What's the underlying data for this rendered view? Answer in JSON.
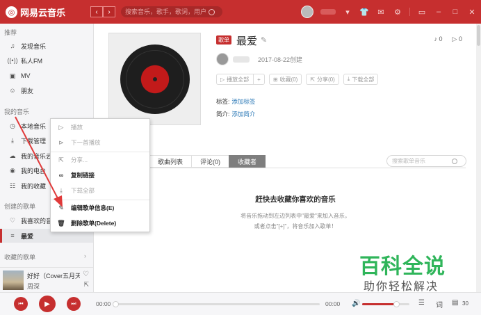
{
  "app": {
    "title": "网易云音乐"
  },
  "search": {
    "placeholder": "搜索音乐，歌手，歌词，用户"
  },
  "sidebar": {
    "section_recommend": "推荐",
    "recommend_items": [
      {
        "label": "发现音乐",
        "icon": "music-note-icon"
      },
      {
        "label": "私人FM",
        "icon": "radio-icon"
      },
      {
        "label": "MV",
        "icon": "mv-icon"
      },
      {
        "label": "朋友",
        "icon": "friends-icon"
      }
    ],
    "section_my_music": "我的音乐",
    "my_music_items": [
      {
        "label": "本地音乐",
        "icon": "local-music-icon"
      },
      {
        "label": "下载管理",
        "icon": "download-icon"
      },
      {
        "label": "我的音乐云盘",
        "icon": "cloud-icon"
      },
      {
        "label": "我的电台",
        "icon": "podcast-icon"
      },
      {
        "label": "我的收藏",
        "icon": "collect-icon"
      }
    ],
    "section_created": "创建的歌单",
    "created_items": [
      {
        "label": "我喜欢的音乐",
        "icon": "heart-icon"
      },
      {
        "label": "最爱",
        "icon": "playlist-icon",
        "active": true
      }
    ],
    "section_collected": "收藏的歌单"
  },
  "now_playing": {
    "title": "好好（Cover五月天）",
    "artist": "周深"
  },
  "playlist": {
    "badge": "歌单",
    "title": "最爱",
    "song_count": "0",
    "play_count": "0",
    "created_date": "2017-08-22创建",
    "actions": {
      "play_all": "播放全部",
      "add": "+",
      "collect": "收藏(0)",
      "share": "分享(0)",
      "download_all": "下载全部"
    },
    "tags_label": "标签:",
    "tags_link": "添加标签",
    "intro_label": "简介:",
    "intro_link": "添加简介"
  },
  "tabs": {
    "songs": "歌曲列表",
    "comments": "评论(0)",
    "collectors": "收藏者"
  },
  "tab_search": {
    "placeholder": "搜索歌单音乐"
  },
  "empty": {
    "title": "赶快去收藏你喜欢的音乐",
    "line1": "将音乐拖动到左边列表中\"最爱\"来加入音乐，",
    "line2": "或者点击\"[+]\"，将音乐加入歌单！"
  },
  "context_menu": {
    "items": [
      {
        "label": "播放",
        "icon": "play-circle-icon",
        "enabled": false
      },
      {
        "label": "下一首播放",
        "icon": "play-next-icon",
        "enabled": false
      },
      {
        "label": "分享...",
        "icon": "share-icon",
        "enabled": false
      },
      {
        "label": "复制链接",
        "icon": "link-icon",
        "enabled": true
      },
      {
        "label": "下载全部",
        "icon": "download-icon",
        "enabled": false
      },
      {
        "label": "编辑歌单信息(E)",
        "icon": "edit-icon",
        "enabled": true
      },
      {
        "label": "删除歌单(Delete)",
        "icon": "trash-icon",
        "enabled": true
      }
    ]
  },
  "player": {
    "current_time": "00:00",
    "total_time": "00:00",
    "volume": 0.72,
    "playlist_count": "30"
  },
  "watermark": {
    "main": "百科全说",
    "sub": "助你轻松解决"
  },
  "colors": {
    "brand": "#c62f2f",
    "link": "#2d7ab7",
    "watermark": "#2fb55a"
  }
}
